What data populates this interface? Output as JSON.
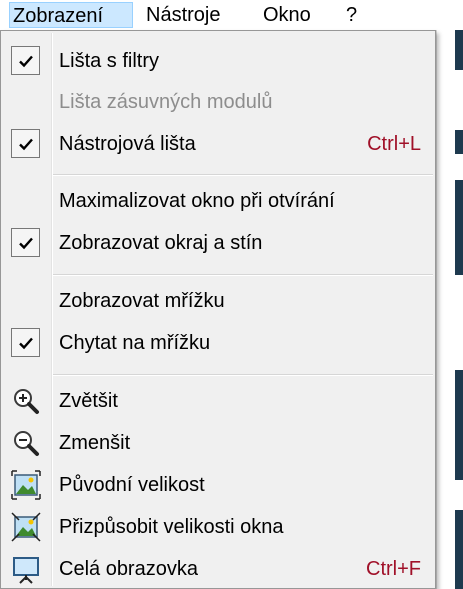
{
  "menubar": {
    "items": [
      "Zobrazení",
      "Nástroje",
      "Okno",
      "?"
    ]
  },
  "menu": {
    "items": [
      {
        "label": "Lišta s filtry",
        "checked": true
      },
      {
        "label": "Lišta zásuvných modulů",
        "disabled": true
      },
      {
        "label": "Nástrojová lišta",
        "checked": true,
        "shortcut": "Ctrl+L"
      },
      {
        "label": "Maximalizovat okno při otvírání"
      },
      {
        "label": "Zobrazovat okraj a stín",
        "checked": true
      },
      {
        "label": "Zobrazovat mřížku"
      },
      {
        "label": "Chytat na mřížku",
        "checked": true
      },
      {
        "label": "Zvětšit",
        "icon": "zoom-in-icon"
      },
      {
        "label": "Zmenšit",
        "icon": "zoom-out-icon"
      },
      {
        "label": "Původní velikost",
        "icon": "original-size-icon"
      },
      {
        "label": "Přizpůsobit velikosti okna",
        "icon": "fit-window-icon"
      },
      {
        "label": "Celá obrazovka",
        "icon": "fullscreen-icon",
        "shortcut": "Ctrl+F"
      }
    ]
  },
  "colors": {
    "shortcut": "#a01028",
    "disabled": "#8d8d8d",
    "active_menu": "#cce8ff"
  }
}
